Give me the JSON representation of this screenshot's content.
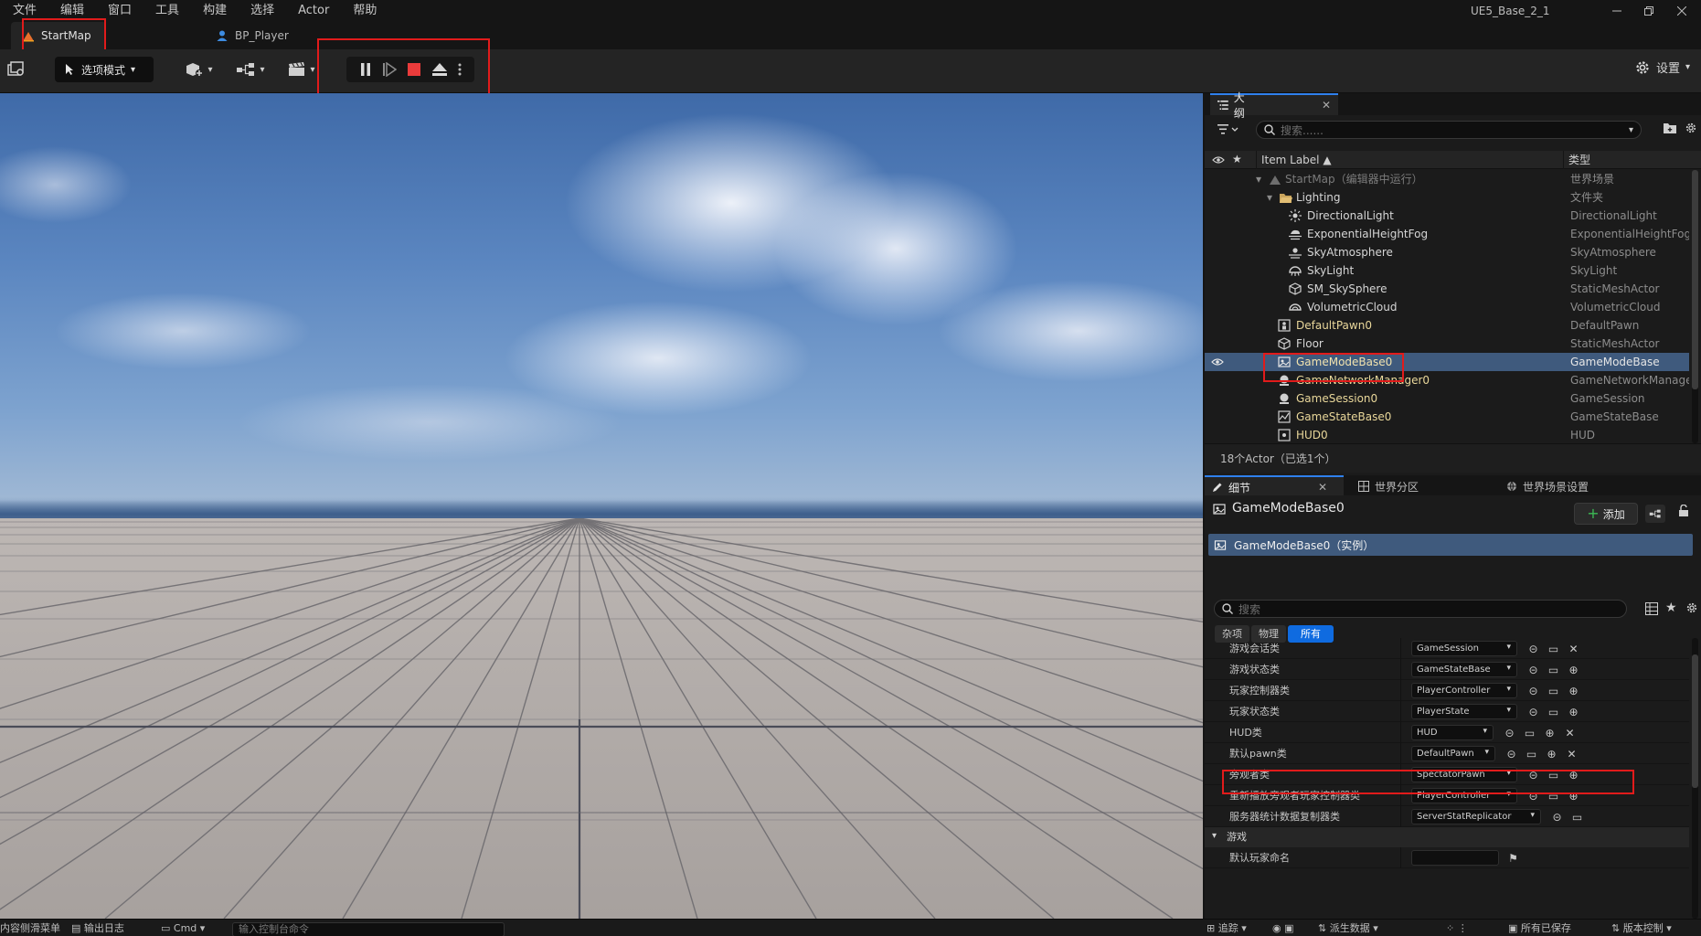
{
  "menubar": {
    "items": [
      "文件",
      "编辑",
      "窗口",
      "工具",
      "构建",
      "选择",
      "Actor",
      "帮助"
    ],
    "app_title": "UE5_Base_2_1"
  },
  "doc_tabs": [
    {
      "label": "StartMap",
      "active": true
    },
    {
      "label": "BP_Player",
      "active": false
    }
  ],
  "toolbar": {
    "mode_label": "选项模式",
    "settings_label": "设置"
  },
  "outliner": {
    "tab_label": "大纲",
    "search_placeholder": "搜索......",
    "col_label": "Item Label ▲",
    "col_type": "类型",
    "rows": [
      {
        "label": "StartMap（编辑器中运行）",
        "type": "世界场景",
        "style": "dim",
        "indent": 0
      },
      {
        "label": "Lighting",
        "type": "文件夹",
        "style": "white",
        "indent": 1
      },
      {
        "label": "DirectionalLight",
        "type": "DirectionalLight",
        "style": "white",
        "indent": 2
      },
      {
        "label": "ExponentialHeightFog",
        "type": "ExponentialHeightFog",
        "style": "white",
        "indent": 2
      },
      {
        "label": "SkyAtmosphere",
        "type": "SkyAtmosphere",
        "style": "white",
        "indent": 2
      },
      {
        "label": "SkyLight",
        "type": "SkyLight",
        "style": "white",
        "indent": 2
      },
      {
        "label": "SM_SkySphere",
        "type": "StaticMeshActor",
        "style": "white",
        "indent": 2
      },
      {
        "label": "VolumetricCloud",
        "type": "VolumetricCloud",
        "style": "white",
        "indent": 2
      },
      {
        "label": "DefaultPawn0",
        "type": "DefaultPawn",
        "style": "yellow",
        "indent": 1
      },
      {
        "label": "Floor",
        "type": "StaticMeshActor",
        "style": "white",
        "indent": 1
      },
      {
        "label": "GameModeBase0",
        "type": "GameModeBase",
        "style": "yellow",
        "indent": 1,
        "selected": true
      },
      {
        "label": "GameNetworkManager0",
        "type": "GameNetworkManage",
        "style": "yellow",
        "indent": 1
      },
      {
        "label": "GameSession0",
        "type": "GameSession",
        "style": "yellow",
        "indent": 1
      },
      {
        "label": "GameStateBase0",
        "type": "GameStateBase",
        "style": "yellow",
        "indent": 1
      },
      {
        "label": "HUD0",
        "type": "HUD",
        "style": "yellow",
        "indent": 1
      }
    ],
    "footer": "18个Actor（已选1个）"
  },
  "details": {
    "tabs": [
      {
        "label": "细节",
        "active": true
      },
      {
        "label": "世界分区",
        "active": false
      },
      {
        "label": "世界场景设置",
        "active": false
      }
    ],
    "object_name": "GameModeBase0",
    "add_label": "添加",
    "instance_label": "GameModeBase0（实例）",
    "search_placeholder": "搜索",
    "filters": [
      {
        "label": "杂项",
        "active": false
      },
      {
        "label": "物理",
        "active": false
      },
      {
        "label": "所有",
        "active": true
      }
    ],
    "properties": [
      {
        "label": "游戏会话类",
        "value": "GameSession",
        "has_clear": true
      },
      {
        "label": "游戏状态类",
        "value": "GameStateBase",
        "has_clear": false
      },
      {
        "label": "玩家控制器类",
        "value": "PlayerController",
        "has_clear": false
      },
      {
        "label": "玩家状态类",
        "value": "PlayerState",
        "has_clear": false
      },
      {
        "label": "HUD类",
        "value": "HUD",
        "has_clear": true
      },
      {
        "label": "默认pawn类",
        "value": "DefaultPawn",
        "has_clear": true
      },
      {
        "label": "旁观者类",
        "value": "SpectatorPawn",
        "has_clear": false
      },
      {
        "label": "重新播放旁观者玩家控制器类",
        "value": "PlayerController",
        "has_clear": false
      },
      {
        "label": "服务器统计数据复制器类",
        "value": "ServerStatReplicator",
        "has_clear": false
      }
    ],
    "section_game": "游戏",
    "default_player_name_label": "默认玩家命名"
  },
  "statusbar": {
    "content_drawer": "内容侧滑菜单",
    "output_log": "输出日志",
    "cmd_label": "Cmd",
    "cmd_placeholder": "输入控制台命令",
    "trace": "追踪",
    "derived_data": "派生数据",
    "all_saved": "所有已保存",
    "source_control": "版本控制"
  },
  "colors": {
    "accent": "#0f6be0",
    "selection": "#3f5a7d",
    "annotation_red": "#e11b1b",
    "actor_yellow": "#e9d79a"
  }
}
